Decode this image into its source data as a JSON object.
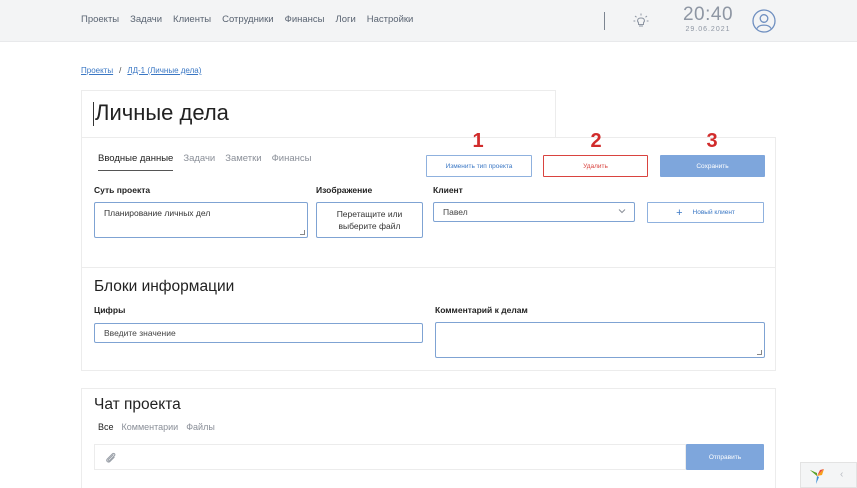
{
  "nav": {
    "items": [
      "Проекты",
      "Задачи",
      "Клиенты",
      "Сотрудники",
      "Финансы",
      "Логи",
      "Настройки"
    ],
    "time": "20:40",
    "date": "29.06.2021"
  },
  "breadcrumb": {
    "root": "Проекты",
    "separator": "/",
    "current": "ЛД-1 (Личные дела)"
  },
  "project": {
    "title": "Личные дела"
  },
  "tabs": [
    "Вводные данные",
    "Задачи",
    "Заметки",
    "Финансы"
  ],
  "annotations": [
    "1",
    "2",
    "3"
  ],
  "actions": {
    "change_type": "Изменить тип проекта",
    "delete": "Удалить",
    "save": "Сохранить"
  },
  "form": {
    "essence_label": "Суть проекта",
    "essence_value": "Планирование личных дел",
    "image_label": "Изображение",
    "image_drop_line1": "Перетащите или",
    "image_drop_line2": "выберите файл",
    "client_label": "Клиент",
    "client_value": "Павел",
    "new_client": "Новый клиент"
  },
  "info_blocks": {
    "heading": "Блоки информации",
    "numbers_label": "Цифры",
    "numbers_placeholder": "Введите значение",
    "comment_label": "Комментарий к делам"
  },
  "chat": {
    "heading": "Чат проекта",
    "tabs": [
      "Все",
      "Комментарии",
      "Файлы"
    ],
    "send": "Отправить"
  },
  "colors": {
    "accent": "#7ea6dc",
    "link": "#3a77c4",
    "danger": "#d9433f",
    "annotation": "#d12c2c"
  }
}
